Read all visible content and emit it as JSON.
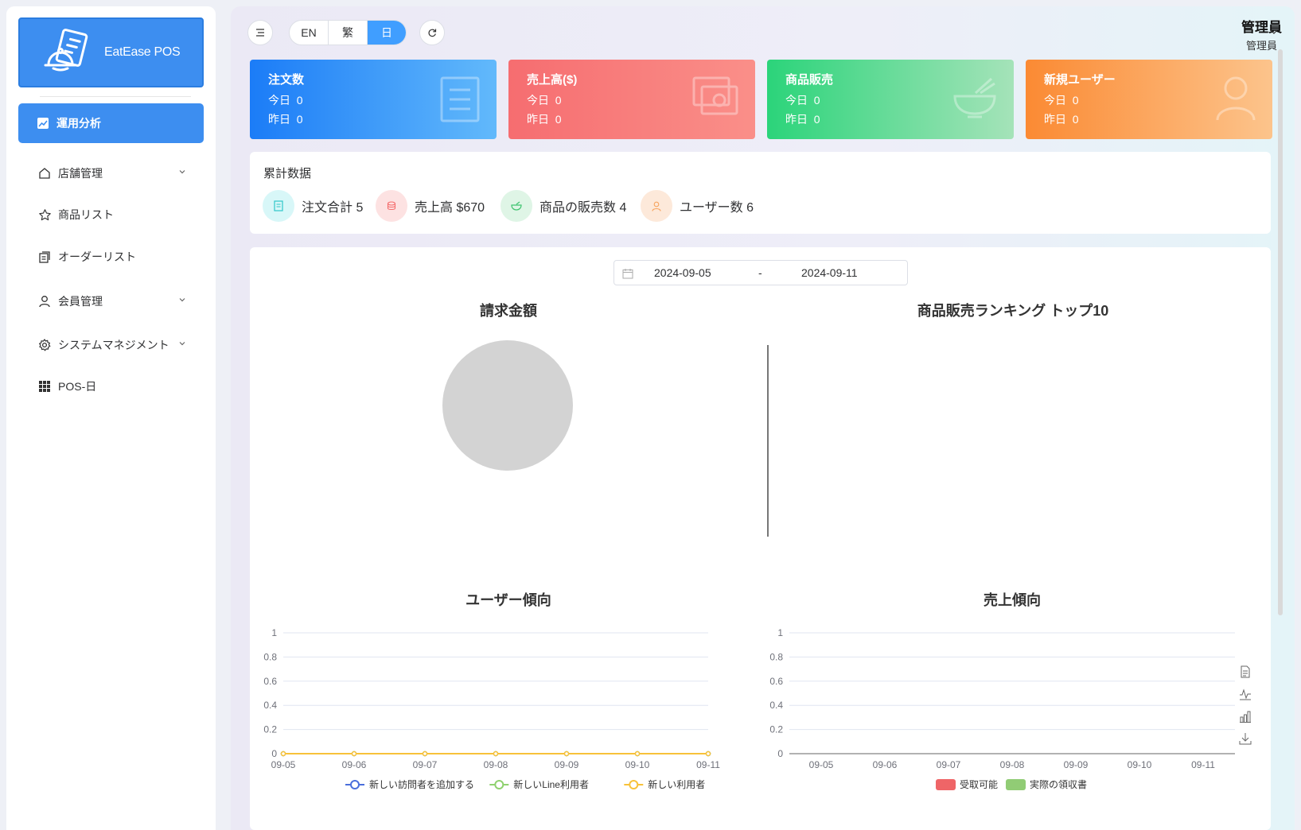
{
  "app": {
    "logo_text": "EatEase POS"
  },
  "sidebar": {
    "active": {
      "label": "運用分析",
      "icon": "chart-icon"
    },
    "items": [
      {
        "label": "店舗管理",
        "icon": "home-icon",
        "expandable": true
      },
      {
        "label": "商品リスト",
        "icon": "star-icon",
        "expandable": false
      },
      {
        "label": "オーダーリスト",
        "icon": "orders-icon",
        "expandable": false
      },
      {
        "label": "会員管理",
        "icon": "user-icon",
        "expandable": true
      },
      {
        "label": "システムマネジメント",
        "icon": "gear-icon",
        "expandable": true
      },
      {
        "label": "POS-日",
        "icon": "grid-icon",
        "expandable": false
      }
    ]
  },
  "topbar": {
    "languages": [
      "EN",
      "繁",
      "日"
    ],
    "active_language": "日",
    "user_name": "管理員",
    "user_role": "管理員"
  },
  "stats": [
    {
      "title": "注文数",
      "today_label": "今日",
      "today": "0",
      "yesterday_label": "昨日",
      "yesterday": "0",
      "icon": "document-icon",
      "color_from": "#1b7cf7",
      "color_to": "#62b9fb"
    },
    {
      "title": "売上高($)",
      "today_label": "今日",
      "today": "0",
      "yesterday_label": "昨日",
      "yesterday": "0",
      "icon": "money-icon",
      "color_from": "#f66d70",
      "color_to": "#fa8f89"
    },
    {
      "title": "商品販売",
      "today_label": "今日",
      "today": "0",
      "yesterday_label": "昨日",
      "yesterday": "0",
      "icon": "bowl-icon",
      "color_from": "#2bd47a",
      "color_to": "#a5e3b9"
    },
    {
      "title": "新規ユーザー",
      "today_label": "今日",
      "today": "0",
      "yesterday_label": "昨日",
      "yesterday": "0",
      "icon": "user-icon",
      "color_from": "#fb8a33",
      "color_to": "#fcc48c"
    }
  ],
  "cumulative": {
    "title": "累計数据",
    "items": [
      {
        "label": "注文合計 5",
        "icon": "document-icon",
        "bg": "#d8f7f8",
        "fg": "#2fc7c9"
      },
      {
        "label": "売上高 $670",
        "icon": "coins-icon",
        "bg": "#fde2e2",
        "fg": "#f56c6c"
      },
      {
        "label": "商品の販売数 4",
        "icon": "bowl-icon",
        "bg": "#dff5e6",
        "fg": "#3fc46f"
      },
      {
        "label": "ユーザー数 6",
        "icon": "user-icon",
        "bg": "#fde9da",
        "fg": "#f7a35c"
      }
    ]
  },
  "date_range": {
    "start": "2024-09-05",
    "separator": "-",
    "end": "2024-09-11"
  },
  "charts": {
    "billing_title": "請求金額",
    "ranking_title": "商品販売ランキング トップ10",
    "user_trend_title": "ユーザー傾向",
    "sales_trend_title": "売上傾向"
  },
  "chart_data": [
    {
      "type": "pie",
      "title": "請求金額",
      "values": [],
      "empty": true
    },
    {
      "type": "bar",
      "title": "商品販売ランキング トップ10",
      "categories": [],
      "values": []
    },
    {
      "type": "line",
      "title": "ユーザー傾向",
      "x": [
        "09-05",
        "09-06",
        "09-07",
        "09-08",
        "09-09",
        "09-10",
        "09-11"
      ],
      "y_ticks": [
        "0",
        "0.2",
        "0.4",
        "0.6",
        "0.8",
        "1"
      ],
      "ylim": [
        0,
        1
      ],
      "grid": true,
      "legend_position": "bottom",
      "series": [
        {
          "name": "新しい訪問者を追加する",
          "color": "#4a6fdc",
          "values": [
            0,
            0,
            0,
            0,
            0,
            0,
            0
          ]
        },
        {
          "name": "新しいLine利用者",
          "color": "#8fd16f",
          "values": [
            0,
            0,
            0,
            0,
            0,
            0,
            0
          ]
        },
        {
          "name": "新しい利用者",
          "color": "#f8c23a",
          "values": [
            0,
            0,
            0,
            0,
            0,
            0,
            0
          ]
        }
      ]
    },
    {
      "type": "bar",
      "title": "売上傾向",
      "categories": [
        "09-05",
        "09-06",
        "09-07",
        "09-08",
        "09-09",
        "09-10",
        "09-11"
      ],
      "y_ticks": [
        "0",
        "0.2",
        "0.4",
        "0.6",
        "0.8",
        "1"
      ],
      "ylim": [
        0,
        1
      ],
      "grid": true,
      "legend_position": "bottom",
      "series": [
        {
          "name": "受取可能",
          "color": "#ef6567",
          "values": [
            0,
            0,
            0,
            0,
            0,
            0,
            0
          ]
        },
        {
          "name": "実際の領収書",
          "color": "#91cc75",
          "values": [
            0,
            0,
            0,
            0,
            0,
            0,
            0
          ]
        }
      ]
    }
  ],
  "toolbox": [
    "data-view-icon",
    "line-switch-icon",
    "bar-switch-icon",
    "download-icon"
  ]
}
